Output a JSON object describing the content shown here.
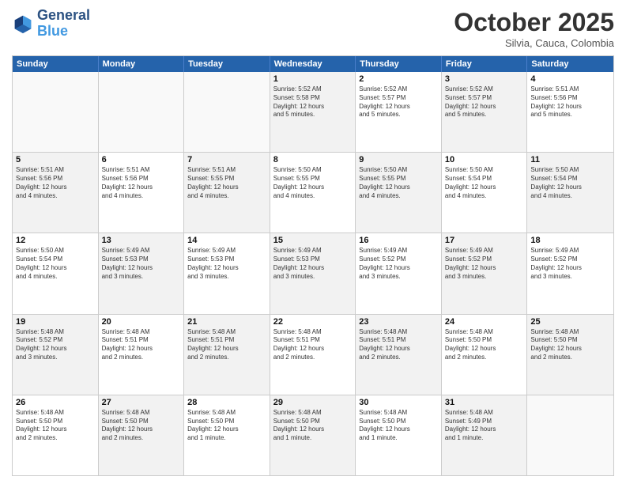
{
  "header": {
    "logo_line1": "General",
    "logo_line2": "Blue",
    "month": "October 2025",
    "location": "Silvia, Cauca, Colombia"
  },
  "weekdays": [
    "Sunday",
    "Monday",
    "Tuesday",
    "Wednesday",
    "Thursday",
    "Friday",
    "Saturday"
  ],
  "rows": [
    [
      {
        "day": "",
        "text": "",
        "empty": true
      },
      {
        "day": "",
        "text": "",
        "empty": true
      },
      {
        "day": "",
        "text": "",
        "empty": true
      },
      {
        "day": "1",
        "text": "Sunrise: 5:52 AM\nSunset: 5:58 PM\nDaylight: 12 hours\nand 5 minutes.",
        "shaded": true
      },
      {
        "day": "2",
        "text": "Sunrise: 5:52 AM\nSunset: 5:57 PM\nDaylight: 12 hours\nand 5 minutes.",
        "shaded": false
      },
      {
        "day": "3",
        "text": "Sunrise: 5:52 AM\nSunset: 5:57 PM\nDaylight: 12 hours\nand 5 minutes.",
        "shaded": true
      },
      {
        "day": "4",
        "text": "Sunrise: 5:51 AM\nSunset: 5:56 PM\nDaylight: 12 hours\nand 5 minutes.",
        "shaded": false
      }
    ],
    [
      {
        "day": "5",
        "text": "Sunrise: 5:51 AM\nSunset: 5:56 PM\nDaylight: 12 hours\nand 4 minutes.",
        "shaded": true
      },
      {
        "day": "6",
        "text": "Sunrise: 5:51 AM\nSunset: 5:56 PM\nDaylight: 12 hours\nand 4 minutes.",
        "shaded": false
      },
      {
        "day": "7",
        "text": "Sunrise: 5:51 AM\nSunset: 5:55 PM\nDaylight: 12 hours\nand 4 minutes.",
        "shaded": true
      },
      {
        "day": "8",
        "text": "Sunrise: 5:50 AM\nSunset: 5:55 PM\nDaylight: 12 hours\nand 4 minutes.",
        "shaded": false
      },
      {
        "day": "9",
        "text": "Sunrise: 5:50 AM\nSunset: 5:55 PM\nDaylight: 12 hours\nand 4 minutes.",
        "shaded": true
      },
      {
        "day": "10",
        "text": "Sunrise: 5:50 AM\nSunset: 5:54 PM\nDaylight: 12 hours\nand 4 minutes.",
        "shaded": false
      },
      {
        "day": "11",
        "text": "Sunrise: 5:50 AM\nSunset: 5:54 PM\nDaylight: 12 hours\nand 4 minutes.",
        "shaded": true
      }
    ],
    [
      {
        "day": "12",
        "text": "Sunrise: 5:50 AM\nSunset: 5:54 PM\nDaylight: 12 hours\nand 4 minutes.",
        "shaded": false
      },
      {
        "day": "13",
        "text": "Sunrise: 5:49 AM\nSunset: 5:53 PM\nDaylight: 12 hours\nand 3 minutes.",
        "shaded": true
      },
      {
        "day": "14",
        "text": "Sunrise: 5:49 AM\nSunset: 5:53 PM\nDaylight: 12 hours\nand 3 minutes.",
        "shaded": false
      },
      {
        "day": "15",
        "text": "Sunrise: 5:49 AM\nSunset: 5:53 PM\nDaylight: 12 hours\nand 3 minutes.",
        "shaded": true
      },
      {
        "day": "16",
        "text": "Sunrise: 5:49 AM\nSunset: 5:52 PM\nDaylight: 12 hours\nand 3 minutes.",
        "shaded": false
      },
      {
        "day": "17",
        "text": "Sunrise: 5:49 AM\nSunset: 5:52 PM\nDaylight: 12 hours\nand 3 minutes.",
        "shaded": true
      },
      {
        "day": "18",
        "text": "Sunrise: 5:49 AM\nSunset: 5:52 PM\nDaylight: 12 hours\nand 3 minutes.",
        "shaded": false
      }
    ],
    [
      {
        "day": "19",
        "text": "Sunrise: 5:48 AM\nSunset: 5:52 PM\nDaylight: 12 hours\nand 3 minutes.",
        "shaded": true
      },
      {
        "day": "20",
        "text": "Sunrise: 5:48 AM\nSunset: 5:51 PM\nDaylight: 12 hours\nand 2 minutes.",
        "shaded": false
      },
      {
        "day": "21",
        "text": "Sunrise: 5:48 AM\nSunset: 5:51 PM\nDaylight: 12 hours\nand 2 minutes.",
        "shaded": true
      },
      {
        "day": "22",
        "text": "Sunrise: 5:48 AM\nSunset: 5:51 PM\nDaylight: 12 hours\nand 2 minutes.",
        "shaded": false
      },
      {
        "day": "23",
        "text": "Sunrise: 5:48 AM\nSunset: 5:51 PM\nDaylight: 12 hours\nand 2 minutes.",
        "shaded": true
      },
      {
        "day": "24",
        "text": "Sunrise: 5:48 AM\nSunset: 5:50 PM\nDaylight: 12 hours\nand 2 minutes.",
        "shaded": false
      },
      {
        "day": "25",
        "text": "Sunrise: 5:48 AM\nSunset: 5:50 PM\nDaylight: 12 hours\nand 2 minutes.",
        "shaded": true
      }
    ],
    [
      {
        "day": "26",
        "text": "Sunrise: 5:48 AM\nSunset: 5:50 PM\nDaylight: 12 hours\nand 2 minutes.",
        "shaded": false
      },
      {
        "day": "27",
        "text": "Sunrise: 5:48 AM\nSunset: 5:50 PM\nDaylight: 12 hours\nand 2 minutes.",
        "shaded": true
      },
      {
        "day": "28",
        "text": "Sunrise: 5:48 AM\nSunset: 5:50 PM\nDaylight: 12 hours\nand 1 minute.",
        "shaded": false
      },
      {
        "day": "29",
        "text": "Sunrise: 5:48 AM\nSunset: 5:50 PM\nDaylight: 12 hours\nand 1 minute.",
        "shaded": true
      },
      {
        "day": "30",
        "text": "Sunrise: 5:48 AM\nSunset: 5:50 PM\nDaylight: 12 hours\nand 1 minute.",
        "shaded": false
      },
      {
        "day": "31",
        "text": "Sunrise: 5:48 AM\nSunset: 5:49 PM\nDaylight: 12 hours\nand 1 minute.",
        "shaded": true
      },
      {
        "day": "",
        "text": "",
        "empty": true
      }
    ]
  ]
}
